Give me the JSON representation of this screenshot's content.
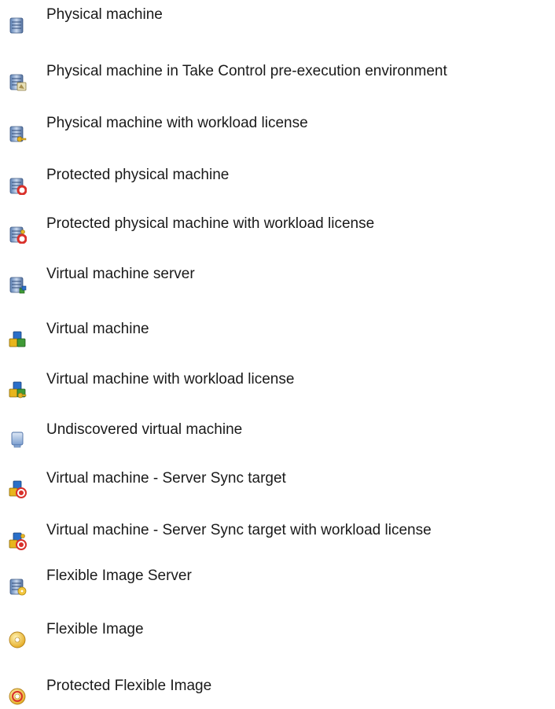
{
  "items": [
    {
      "label": "Physical machine",
      "icon": "server-icon",
      "badge": "none"
    },
    {
      "label": "Physical machine in Take Control pre-execution environment",
      "icon": "server-icon",
      "badge": "take-control-icon"
    },
    {
      "label": "Physical machine with workload license",
      "icon": "server-icon",
      "badge": "key-icon"
    },
    {
      "label": "Protected physical machine",
      "icon": "server-icon",
      "badge": "lifebuoy-icon"
    },
    {
      "label": "Protected physical machine with workload license",
      "icon": "server-icon",
      "badge": "lifebuoy-key-icon"
    },
    {
      "label": "Virtual machine server",
      "icon": "server-icon",
      "badge": "vm-cubes-icon"
    },
    {
      "label": "Virtual machine",
      "icon": "vm-cubes-icon",
      "badge": "none"
    },
    {
      "label": "Virtual machine with workload license",
      "icon": "vm-cubes-icon",
      "badge": "key-icon"
    },
    {
      "label": "Undiscovered virtual machine",
      "icon": "monitor-icon",
      "badge": "none"
    },
    {
      "label": "Virtual machine - Server Sync target",
      "icon": "vm-cubes-icon",
      "badge": "sync-target-icon"
    },
    {
      "label": "Virtual machine - Server Sync target with workload license",
      "icon": "vm-cubes-icon",
      "badge": "sync-target-key-icon"
    },
    {
      "label": "Flexible Image Server",
      "icon": "server-icon",
      "badge": "disc-icon"
    },
    {
      "label": "Flexible Image",
      "icon": "disc-icon",
      "badge": "none"
    },
    {
      "label": "Protected Flexible Image",
      "icon": "disc-icon",
      "badge": "lifebuoy-icon"
    }
  ]
}
